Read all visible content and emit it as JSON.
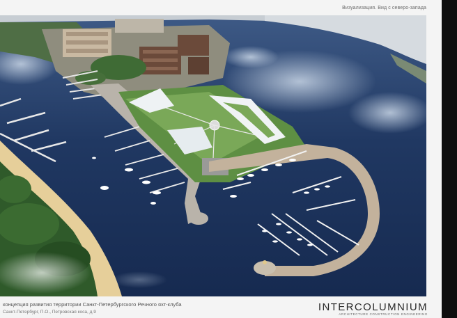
{
  "caption": "Визуализация. Вид с северо-запада",
  "footer": {
    "title": "концепция развития территории Санкт-Петербургского Речного яхт-клуба",
    "address": "Санкт-Петербург, П.О., Петровская коса, д.9"
  },
  "brand": {
    "name": "INTERCOLUMNIUM",
    "tagline": "ARCHITECTURE CONSTRUCTION ENGINEERING"
  },
  "colors": {
    "water": "#1f3560",
    "beach": "#e6cf9a",
    "forest": "#2f5a2a",
    "pier": "#b9b3aa",
    "park": "#5e8f43",
    "border": "#0e0e0e"
  }
}
